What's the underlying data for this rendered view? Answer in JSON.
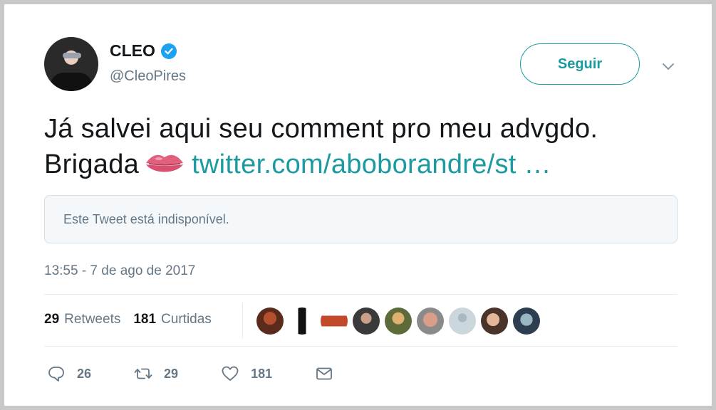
{
  "author": {
    "name": "CLEO",
    "handle": "@CleoPires",
    "verified": true
  },
  "follow_button": {
    "label": "Seguir"
  },
  "tweet": {
    "line1": "Já salvei aqui seu comment pro meu advgdo.",
    "line2_prefix": "Brigada",
    "emoji": "kiss-mark",
    "link_text": "twitter.com/aboborandre/st …"
  },
  "quoted_tweet": {
    "text": "Este Tweet está indisponível."
  },
  "timestamp": "13:55 - 7 de ago de 2017",
  "stats": {
    "retweets_count": "29",
    "retweets_label": "Retweets",
    "likes_count": "181",
    "likes_label": "Curtidas"
  },
  "actions": {
    "reply_count": "26",
    "retweet_count": "29",
    "like_count": "181"
  },
  "colors": {
    "accent": "#1b9aa0",
    "verified": "#1da1f2",
    "muted": "#657786"
  }
}
